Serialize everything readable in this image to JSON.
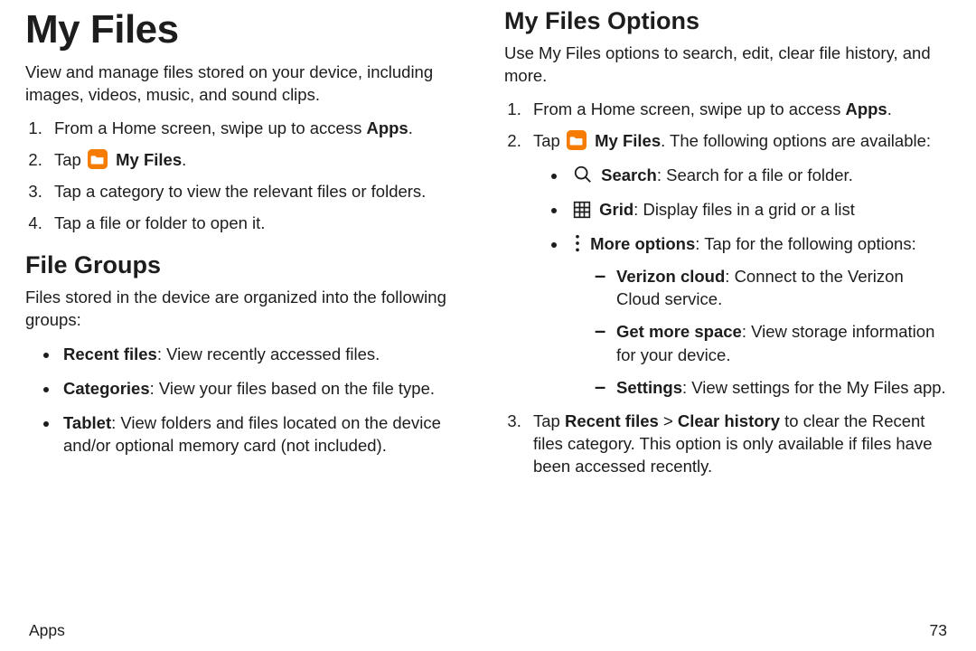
{
  "left": {
    "title": "My Files",
    "intro": "View and manage files stored on your device, including images, videos, music, and sound clips.",
    "steps": {
      "s1_pre": "From a Home screen, swipe up to access ",
      "s1_bold": "Apps",
      "s1_post": ".",
      "s2_pre": "Tap ",
      "s2_bold": "My Files",
      "s2_post": ".",
      "s3": "Tap a category to view the relevant files or folders.",
      "s4": "Tap a file or folder to open it."
    },
    "groups_heading": "File Groups",
    "groups_intro": "Files stored in the device are organized into the following groups:",
    "groups": {
      "g1_bold": "Recent files",
      "g1_sep": ": ",
      "g1_rest": "View recently accessed files.",
      "g2_bold": "Categories",
      "g2_sep": ": ",
      "g2_rest": "View your files based on the file type.",
      "g3_bold": "Tablet",
      "g3_sep": ": ",
      "g3_rest": "View folders and files located on the device and/or optional memory card (not included)."
    }
  },
  "right": {
    "heading": "My Files Options",
    "intro": "Use My Files options to search, edit, clear file history, and more.",
    "steps": {
      "s1_pre": "From a Home screen, swipe up to access ",
      "s1_bold": "Apps",
      "s1_post": ".",
      "s2_pre": "Tap ",
      "s2_bold": "My Files",
      "s2_post": ". The following options are available:",
      "s3_a": "Tap ",
      "s3_b": "Recent files",
      "s3_c": " > ",
      "s3_d": "Clear history",
      "s3_e": " to clear the Recent files category. This option is only available if files have been accessed recently."
    },
    "options": {
      "o1_bold": "Search",
      "o1_sep": ": ",
      "o1_rest": "Search for a file or folder.",
      "o2_bold": "Grid",
      "o2_sep": ": ",
      "o2_rest": "Display files in a grid or a list",
      "o3_bold": "More options",
      "o3_sep": ": ",
      "o3_rest": "Tap for the following options:"
    },
    "more": {
      "m1_bold": "Verizon cloud",
      "m1_sep": ": ",
      "m1_rest": "Connect to the Verizon Cloud service.",
      "m2_bold": "Get more space",
      "m2_sep": ": ",
      "m2_rest": "View storage information for your device.",
      "m3_bold": "Settings",
      "m3_sep": ": ",
      "m3_rest": "View settings for the My Files app."
    }
  },
  "footer": {
    "section": "Apps",
    "page": "73"
  },
  "colors": {
    "folder_icon": "#f57c00"
  }
}
